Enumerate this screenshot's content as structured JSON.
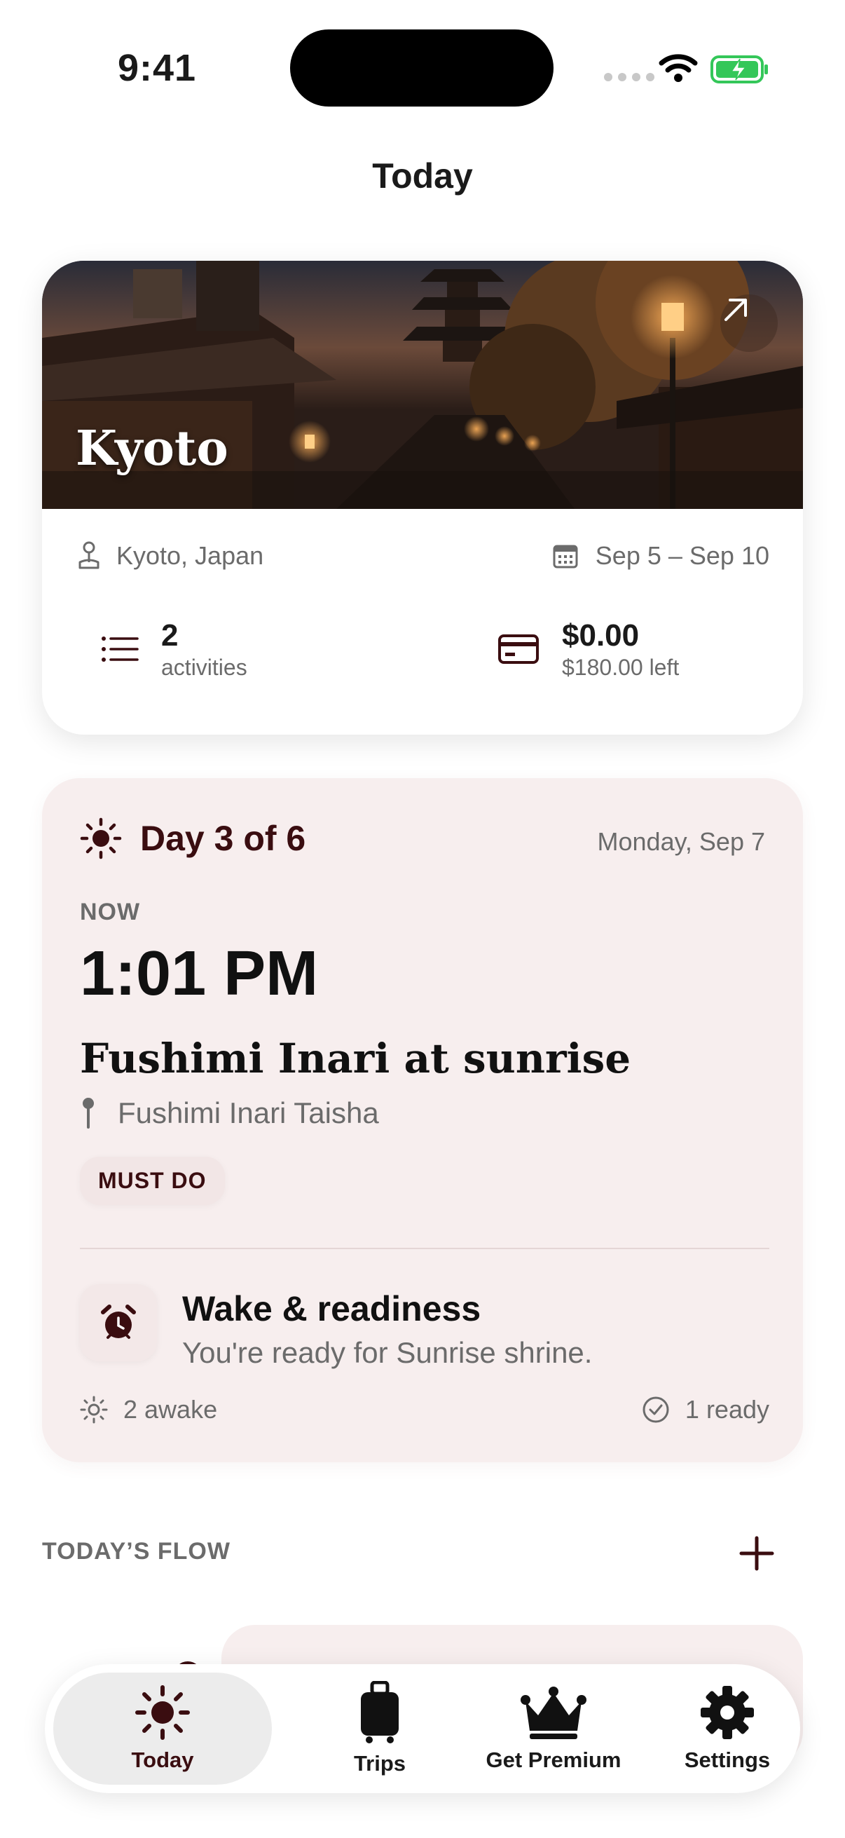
{
  "status_bar": {
    "time": "9:41"
  },
  "page": {
    "title": "Today"
  },
  "trip": {
    "city": "Kyoto",
    "location": "Kyoto, Japan",
    "dates": "Sep 5 – Sep 10",
    "activities_count": "2",
    "activities_label": "activities",
    "spent": "$0.00",
    "budget_left": "$180.00 left"
  },
  "day": {
    "label": "Day 3 of 6",
    "date": "Monday, Sep 7",
    "now_label": "NOW",
    "now_time": "1:01 PM",
    "activity_title": "Fushimi Inari at sunrise",
    "activity_place": "Fushimi Inari Taisha",
    "badge": "MUST DO",
    "wake_title": "Wake & readiness",
    "wake_subtitle": "You're ready for Sunrise shrine.",
    "awake_count": "2 awake",
    "ready_count": "1 ready"
  },
  "flow": {
    "header": "TODAY’S FLOW"
  },
  "tabs": [
    {
      "label": "Today",
      "icon": "sun-icon",
      "active": true
    },
    {
      "label": "Trips",
      "icon": "suitcase-icon"
    },
    {
      "label": "Get Premium",
      "icon": "crown-icon"
    },
    {
      "label": "Settings",
      "icon": "gear-icon"
    }
  ],
  "colors": {
    "accent": "#3a0d10",
    "card_tint": "#f7eeee",
    "battery": "#34c759"
  }
}
